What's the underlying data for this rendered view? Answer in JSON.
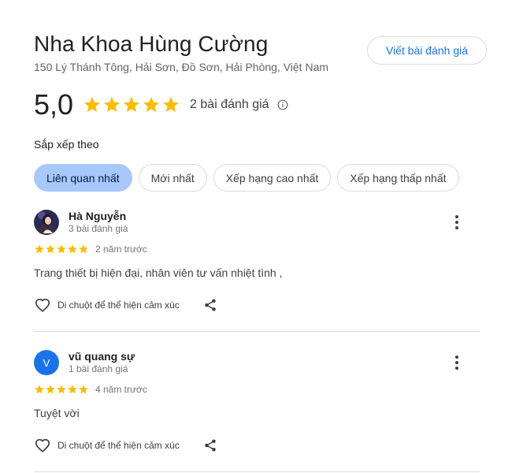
{
  "place": {
    "name": "Nha Khoa Hùng Cường",
    "address": "150 Lý Thánh Tông, Hải Sơn, Đồ Sơn, Hải Phòng, Việt Nam",
    "write_review_label": "Viết bài đánh giá"
  },
  "summary": {
    "rating": "5,0",
    "stars": 5,
    "review_count_label": "2 bài đánh giá",
    "star_color": "#fbbc04"
  },
  "sort": {
    "label": "Sắp xếp theo",
    "options": [
      "Liên quan nhất",
      "Mới nhất",
      "Xếp hạng cao nhất",
      "Xếp hạng thấp nhất"
    ],
    "selected": "Liên quan nhất"
  },
  "reviews": [
    {
      "name": "Hà Nguyễn",
      "meta": "3 bài đánh giá",
      "stars": 5,
      "time": "2 năm trước",
      "text": "Trang thiết bị hiện đại, nhân viên tư vấn nhiệt tình ,",
      "reaction_label": "Di chuột để thể hiện cảm xúc"
    },
    {
      "name": "vũ quang sự",
      "avatar_letter": "V",
      "meta": "1 bài đánh giá",
      "stars": 5,
      "time": "4 năm trước",
      "text": "Tuyệt vời",
      "reaction_label": "Di chuột để thể hiện cảm xúc"
    }
  ]
}
